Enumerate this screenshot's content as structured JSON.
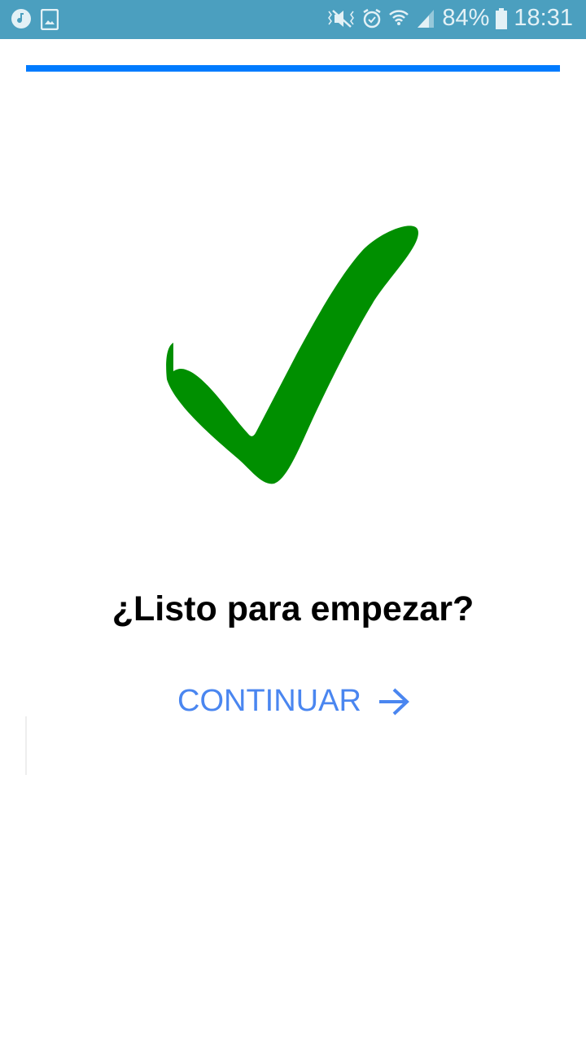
{
  "status_bar": {
    "battery": "84%",
    "time": "18:31",
    "icons": [
      "music-icon",
      "image-icon",
      "vibrate-mute-icon",
      "alarm-icon",
      "wifi-icon",
      "signal-icon",
      "battery-icon"
    ]
  },
  "progress": {
    "value_percent": 100,
    "color": "#007bff"
  },
  "check_color": "#008f00",
  "main": {
    "title": "¿Listo para empezar?",
    "continue_label": "CONTINUAR",
    "accent": "#4a86f0"
  }
}
